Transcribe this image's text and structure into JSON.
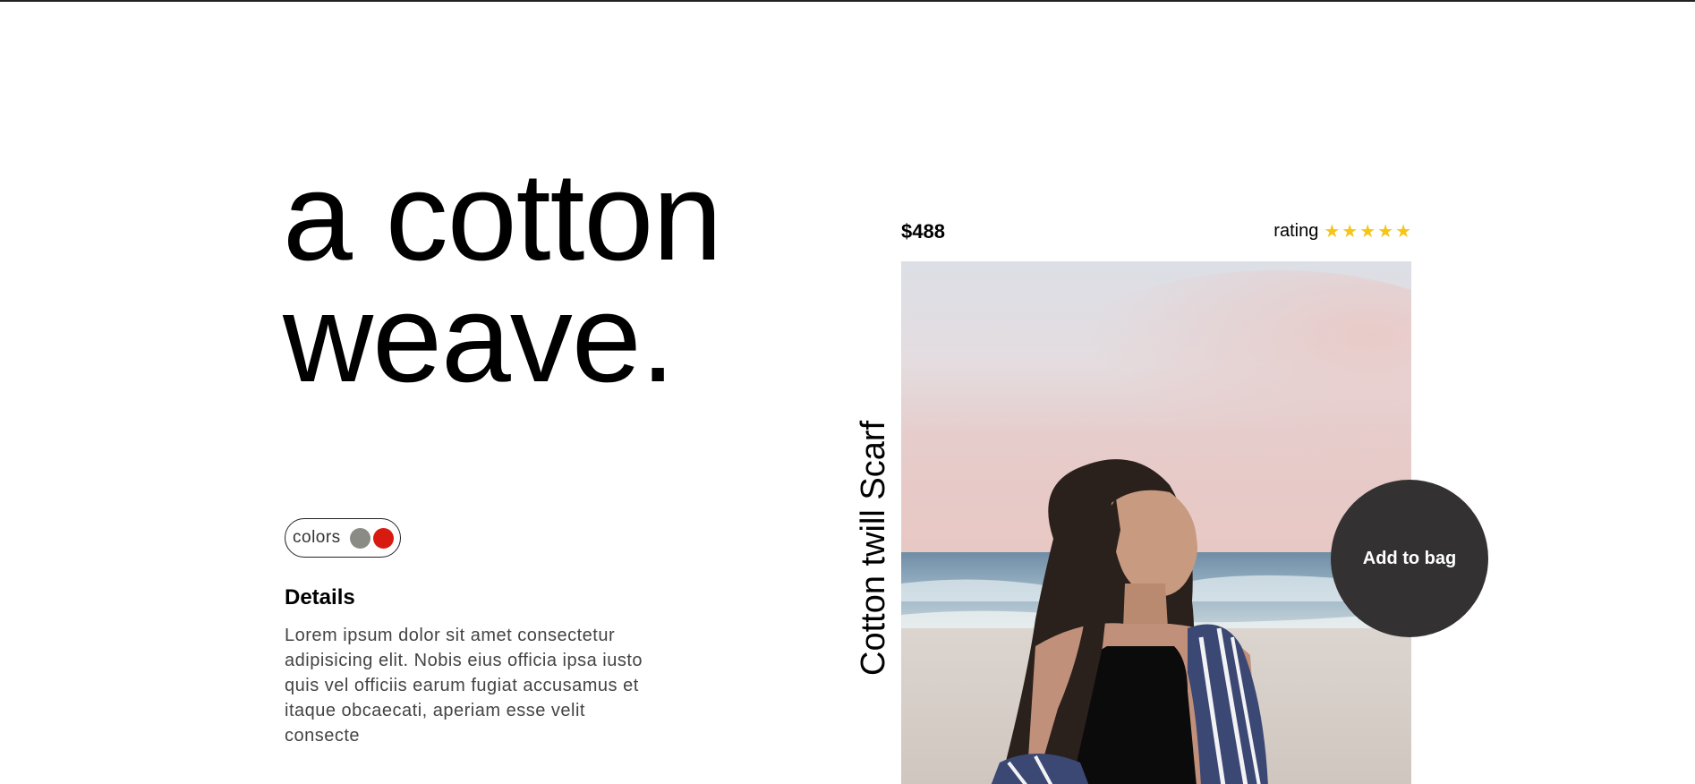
{
  "hero": {
    "line1": "a cotton",
    "line2": "weave."
  },
  "colors": {
    "label": "colors",
    "swatches": [
      {
        "name": "grey",
        "hex": "#8a8b84"
      },
      {
        "name": "red",
        "hex": "#d81b10"
      }
    ]
  },
  "details": {
    "title": "Details",
    "text": "Lorem ipsum dolor sit amet consectetur adipisicing elit. Nobis eius officia ipsa iusto quis vel officiis earum fugiat accusamus et itaque obcaecati, aperiam esse velit consecte"
  },
  "product": {
    "name": "Cotton twill Scarf",
    "price": "$488",
    "rating_label": "rating",
    "rating_value": 5,
    "rating_max": 5,
    "star_color": "#f5c518",
    "star_glyph": "★"
  },
  "actions": {
    "add_to_bag": "Add to bag",
    "button_color": "#333132"
  },
  "image": {
    "icon": "product-photo"
  }
}
